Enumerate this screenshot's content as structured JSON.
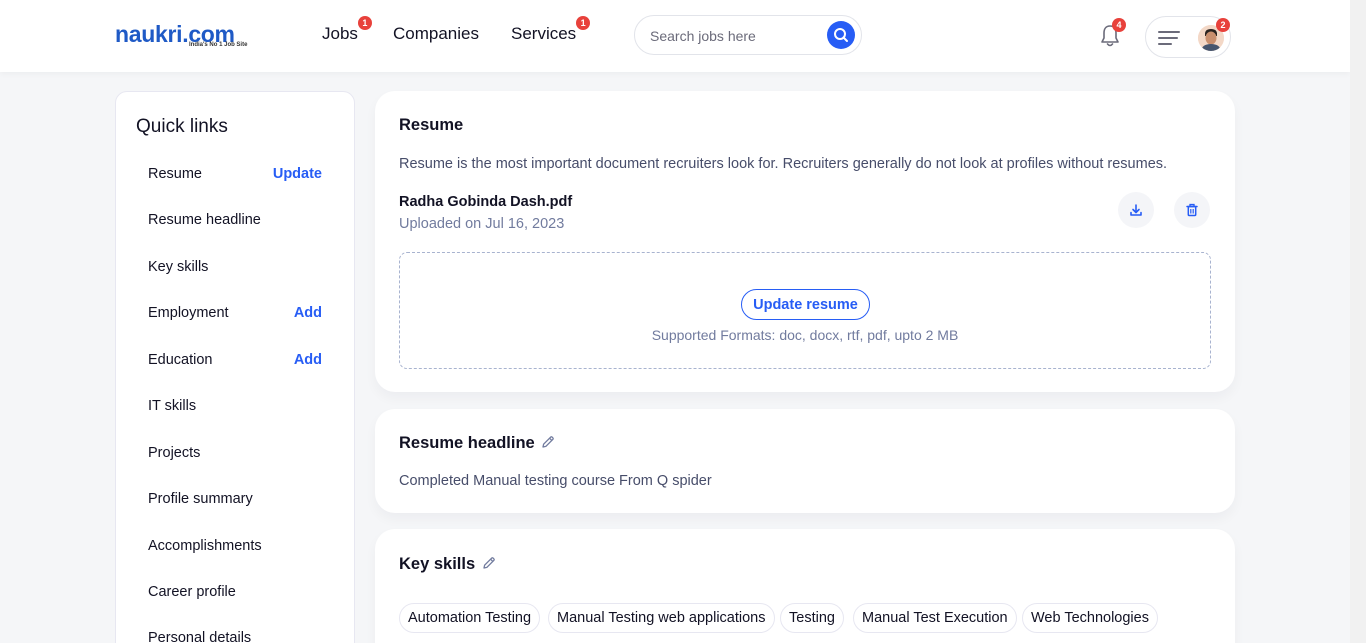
{
  "header": {
    "logo_text": "naukri.com",
    "logo_tagline": "India's No 1 Job Site",
    "nav": [
      {
        "label": "Jobs",
        "badge": "1"
      },
      {
        "label": "Companies",
        "badge": ""
      },
      {
        "label": "Services",
        "badge": "1"
      }
    ],
    "search_placeholder": "Search jobs here",
    "notifications_badge": "4",
    "profile_badge": "2"
  },
  "sidebar": {
    "title": "Quick links",
    "items": [
      {
        "label": "Resume",
        "action": "Update"
      },
      {
        "label": "Resume headline",
        "action": ""
      },
      {
        "label": "Key skills",
        "action": ""
      },
      {
        "label": "Employment",
        "action": "Add"
      },
      {
        "label": "Education",
        "action": "Add"
      },
      {
        "label": "IT skills",
        "action": ""
      },
      {
        "label": "Projects",
        "action": ""
      },
      {
        "label": "Profile summary",
        "action": ""
      },
      {
        "label": "Accomplishments",
        "action": ""
      },
      {
        "label": "Career profile",
        "action": ""
      },
      {
        "label": "Personal details",
        "action": ""
      }
    ]
  },
  "resume": {
    "title": "Resume",
    "description": "Resume is the most important document recruiters look for. Recruiters generally do not look at profiles without resumes.",
    "file_name": "Radha Gobinda Dash.pdf",
    "uploaded": "Uploaded on Jul 16, 2023",
    "update_button": "Update resume",
    "formats": "Supported Formats: doc, docx, rtf, pdf, upto 2 MB"
  },
  "headline": {
    "title": "Resume headline",
    "text": "Completed Manual testing course From Q spider"
  },
  "key_skills": {
    "title": "Key skills",
    "chips": [
      "Automation Testing",
      "Manual Testing web applications",
      "Testing",
      "Manual Test Execution",
      "Web Technologies"
    ]
  },
  "colors": {
    "brand_blue": "#275df5",
    "badge_red": "#e8413b"
  }
}
